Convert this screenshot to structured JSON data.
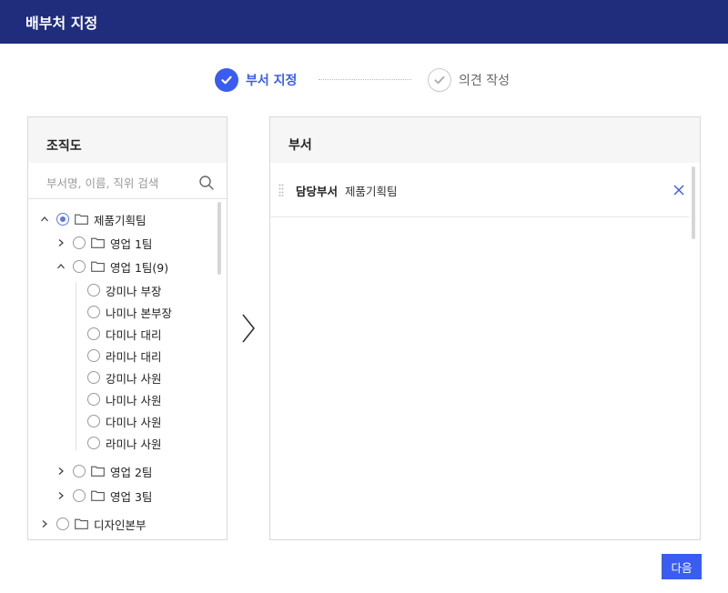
{
  "dialog": {
    "title": "배부처 지정"
  },
  "steps": [
    {
      "label": "부서 지정",
      "state": "active"
    },
    {
      "label": "의견 작성",
      "state": "pending"
    }
  ],
  "colors": {
    "header_bg": "#1f2d7c",
    "accent": "#3a5cf0"
  },
  "org_panel": {
    "title": "조직도",
    "search_placeholder": "부서명, 이름, 직위 검색",
    "tree": [
      {
        "label": "제품기획팀",
        "expanded": true,
        "selected": true,
        "folder": true
      },
      {
        "label": "영업 1팀",
        "expanded": false,
        "selected": false,
        "folder": true
      },
      {
        "label": "영업 1팀(9)",
        "expanded": true,
        "selected": false,
        "folder": true
      },
      {
        "label": "강미나 부장",
        "selected": false
      },
      {
        "label": "나미나 본부장",
        "selected": false
      },
      {
        "label": "다미나 대리",
        "selected": false
      },
      {
        "label": "라미나 대리",
        "selected": false
      },
      {
        "label": "강미나 사원",
        "selected": false
      },
      {
        "label": "나미나 사원",
        "selected": false
      },
      {
        "label": "다미나 사원",
        "selected": false
      },
      {
        "label": "라미나 사원",
        "selected": false
      },
      {
        "label": "영업 2팀",
        "expanded": false,
        "selected": false,
        "folder": true
      },
      {
        "label": "영업 3팀",
        "expanded": false,
        "selected": false,
        "folder": true
      },
      {
        "label": "디자인본부",
        "expanded": false,
        "selected": false,
        "folder": true
      }
    ]
  },
  "dept_panel": {
    "title": "부서",
    "rows": [
      {
        "type": "담당부서",
        "name": "제품기획팀"
      }
    ]
  },
  "next_button": "다음"
}
